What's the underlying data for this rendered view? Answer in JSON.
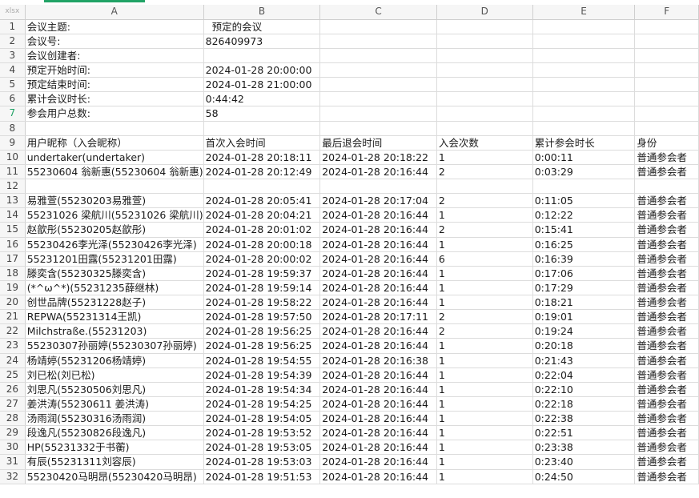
{
  "sheet": {
    "corner_label": "xlsx",
    "columns": [
      "A",
      "B",
      "C",
      "D",
      "E",
      "F"
    ],
    "selected_row": "7",
    "rows": [
      {
        "num": "1",
        "cells": [
          "会议主题:",
          "  预定的会议",
          "",
          "",
          "",
          ""
        ]
      },
      {
        "num": "2",
        "cells": [
          "会议号:",
          "826409973",
          "",
          "",
          "",
          ""
        ]
      },
      {
        "num": "3",
        "cells": [
          "会议创建者:",
          "",
          "",
          "",
          "",
          ""
        ]
      },
      {
        "num": "4",
        "cells": [
          "预定开始时间:",
          "2024-01-28 20:00:00",
          "",
          "",
          "",
          ""
        ]
      },
      {
        "num": "5",
        "cells": [
          "预定结束时间:",
          "2024-01-28 21:00:00",
          "",
          "",
          "",
          ""
        ]
      },
      {
        "num": "6",
        "cells": [
          "累计会议时长:",
          "0:44:42",
          "",
          "",
          "",
          ""
        ]
      },
      {
        "num": "7",
        "cells": [
          "参会用户总数:",
          "58",
          "",
          "",
          "",
          ""
        ]
      },
      {
        "num": "8",
        "cells": [
          "",
          "",
          "",
          "",
          "",
          ""
        ]
      },
      {
        "num": "9",
        "cells": [
          "用户昵称（入会昵称）",
          "首次入会时间",
          "最后退会时间",
          "入会次数",
          "累计参会时长",
          "身份"
        ]
      },
      {
        "num": "10",
        "cells": [
          "undertaker(undertaker)",
          "2024-01-28 20:18:11",
          "2024-01-28 20:18:22",
          "1",
          "0:00:11",
          "普通参会者"
        ]
      },
      {
        "num": "11",
        "cells": [
          "55230604 翁新惠(55230604 翁新惠)",
          "2024-01-28 20:12:49",
          "2024-01-28 20:16:44",
          "2",
          "0:03:29",
          "普通参会者"
        ]
      },
      {
        "num": "12",
        "cells": [
          "",
          "",
          "",
          "",
          "",
          ""
        ]
      },
      {
        "num": "13",
        "cells": [
          "易雅萱(55230203易雅萱)",
          "2024-01-28 20:05:41",
          "2024-01-28 20:17:04",
          "2",
          "0:11:05",
          "普通参会者"
        ]
      },
      {
        "num": "14",
        "cells": [
          "55231026 梁航川(55231026 梁航川)",
          "2024-01-28 20:04:21",
          "2024-01-28 20:16:44",
          "1",
          "0:12:22",
          "普通参会者"
        ]
      },
      {
        "num": "15",
        "cells": [
          "赵歆彤(55230205赵歆彤)",
          "2024-01-28 20:01:02",
          "2024-01-28 20:16:44",
          "2",
          "0:15:41",
          "普通参会者"
        ]
      },
      {
        "num": "16",
        "cells": [
          "55230426李光泽(55230426李光泽)",
          "2024-01-28 20:00:18",
          "2024-01-28 20:16:44",
          "1",
          "0:16:25",
          "普通参会者"
        ]
      },
      {
        "num": "17",
        "cells": [
          "55231201田露(55231201田露)",
          "2024-01-28 20:00:02",
          "2024-01-28 20:16:44",
          "6",
          "0:16:39",
          "普通参会者"
        ]
      },
      {
        "num": "18",
        "cells": [
          "滕奕含(55230325滕奕含)",
          "2024-01-28 19:59:37",
          "2024-01-28 20:16:44",
          "1",
          "0:17:06",
          "普通参会者"
        ]
      },
      {
        "num": "19",
        "cells": [
          "(*^ω^*)(55231235薛继林)",
          "2024-01-28 19:59:14",
          "2024-01-28 20:16:44",
          "1",
          "0:17:29",
          "普通参会者"
        ]
      },
      {
        "num": "20",
        "cells": [
          "创世品牌(55231228赵子)",
          "2024-01-28 19:58:22",
          "2024-01-28 20:16:44",
          "1",
          "0:18:21",
          "普通参会者"
        ]
      },
      {
        "num": "21",
        "cells": [
          "REPWA(55231314王凯)",
          "2024-01-28 19:57:50",
          "2024-01-28 20:17:11",
          "2",
          "0:19:01",
          "普通参会者"
        ]
      },
      {
        "num": "22",
        "cells": [
          "Milchstraße.(55231203)",
          "2024-01-28 19:56:25",
          "2024-01-28 20:16:44",
          "2",
          "0:19:24",
          "普通参会者"
        ]
      },
      {
        "num": "23",
        "cells": [
          "55230307孙丽婷(55230307孙丽婷)",
          "2024-01-28 19:56:25",
          "2024-01-28 20:16:44",
          "1",
          "0:20:18",
          "普通参会者"
        ]
      },
      {
        "num": "24",
        "cells": [
          "杨靖婷(55231206杨靖婷)",
          "2024-01-28 19:54:55",
          "2024-01-28 20:16:38",
          "1",
          "0:21:43",
          "普通参会者"
        ]
      },
      {
        "num": "25",
        "cells": [
          "刘已松(刘已松)",
          "2024-01-28 19:54:39",
          "2024-01-28 20:16:44",
          "1",
          "0:22:04",
          "普通参会者"
        ]
      },
      {
        "num": "26",
        "cells": [
          "刘思凡(55230506刘思凡)",
          "2024-01-28 19:54:34",
          "2024-01-28 20:16:44",
          "1",
          "0:22:10",
          "普通参会者"
        ]
      },
      {
        "num": "27",
        "cells": [
          "姜洪涛(55230611 姜洪涛)",
          "2024-01-28 19:54:25",
          "2024-01-28 20:16:44",
          "1",
          "0:22:18",
          "普通参会者"
        ]
      },
      {
        "num": "28",
        "cells": [
          "汤雨润(55230316汤雨润)",
          "2024-01-28 19:54:05",
          "2024-01-28 20:16:44",
          "1",
          "0:22:38",
          "普通参会者"
        ]
      },
      {
        "num": "29",
        "cells": [
          "段逸凡(55230826段逸凡)",
          "2024-01-28 19:53:52",
          "2024-01-28 20:16:44",
          "1",
          "0:22:51",
          "普通参会者"
        ]
      },
      {
        "num": "30",
        "cells": [
          "HP(55231332于书蘅)",
          "2024-01-28 19:53:05",
          "2024-01-28 20:16:44",
          "1",
          "0:23:38",
          "普通参会者"
        ]
      },
      {
        "num": "31",
        "cells": [
          "有辰(55231311刘容辰)",
          "2024-01-28 19:53:03",
          "2024-01-28 20:16:44",
          "1",
          "0:23:40",
          "普通参会者"
        ]
      },
      {
        "num": "32",
        "cells": [
          "55230420马明昂(55230420马明昂)",
          "2024-01-28 19:51:53",
          "2024-01-28 20:16:44",
          "1",
          "0:24:50",
          "普通参会者"
        ]
      }
    ]
  }
}
